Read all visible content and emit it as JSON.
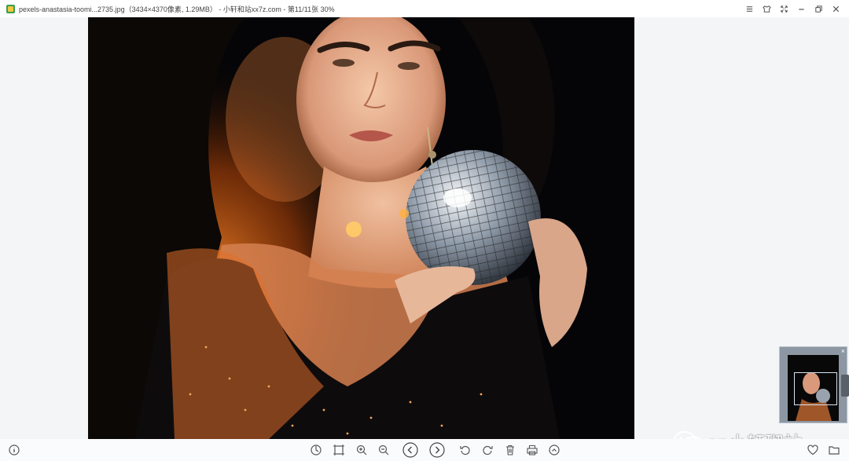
{
  "titlebar": {
    "title": "pexels-anastasia-toomi...2735.jpg（3434×4370像素, 1.29MB） - 小轩和站xx7z.com - 第11/11张 30%",
    "controls": [
      "menu-icon",
      "skin-icon",
      "fullscreen-icon",
      "minimize-icon",
      "restore-icon",
      "close-icon"
    ]
  },
  "watermark": {
    "text": "an小轩砌站"
  },
  "toolbar": {
    "left": [
      "info-icon"
    ],
    "center": [
      "original-size-icon",
      "fit-window-icon",
      "zoom-in-icon",
      "zoom-out-icon",
      "previous-icon",
      "next-icon",
      "rotate-left-icon",
      "rotate-right-icon",
      "delete-icon",
      "print-icon",
      "more-icon"
    ],
    "right": [
      "favorite-icon",
      "open-folder-icon"
    ]
  },
  "colors": {
    "accent_glow": "#ff7a1a",
    "photo_bg": "#050507",
    "window_bg": "#f4f5f7"
  }
}
